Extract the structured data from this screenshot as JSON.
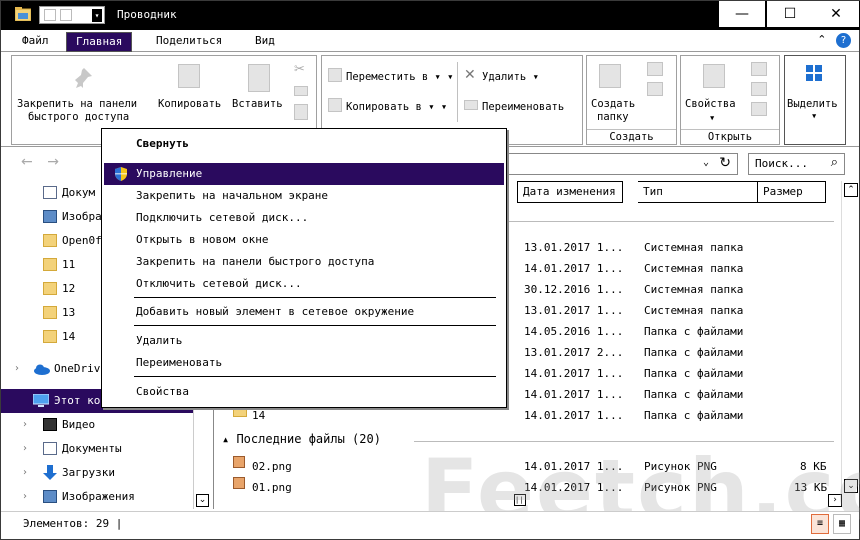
{
  "window": {
    "title": "Проводник",
    "qat_arrow": "▾",
    "minimize": "—",
    "maximize": "☐",
    "close": "✕"
  },
  "tabs": [
    "Файл",
    "Главная",
    "Поделиться",
    "Вид"
  ],
  "tabs_right": {
    "collapse": "⌃",
    "help": "?"
  },
  "ribbon": {
    "pin_label_1": "Закрепить на панели",
    "pin_label_2": "быстрого доступа",
    "copy_label": "Копировать",
    "paste_label": "Вставить",
    "move_to": "Переместить в",
    "copy_to": "Копировать в",
    "delete": "Удалить",
    "rename": "Переименовать",
    "new_folder_1": "Создать",
    "new_folder_2": "папку",
    "group_create": "Создать",
    "properties": "Свойства",
    "group_open": "Открыть",
    "select": "Выделить",
    "caret": "▾"
  },
  "nav": {
    "back": "←",
    "forward": "→",
    "address_caret": "⌄",
    "refresh": "↻",
    "search_placeholder": "Поиск...",
    "search_icon": "⌕"
  },
  "left_pane": {
    "items": [
      {
        "label": "Докум",
        "icon": "document-icon"
      },
      {
        "label": "Изобра",
        "icon": "images-icon"
      },
      {
        "label": "Open0f",
        "icon": "folder-icon"
      },
      {
        "label": "11",
        "icon": "folder-icon"
      },
      {
        "label": "12",
        "icon": "folder-icon"
      },
      {
        "label": "13",
        "icon": "folder-icon"
      },
      {
        "label": "14",
        "icon": "folder-icon"
      },
      {
        "label": "OneDriv",
        "icon": "onedrive-icon"
      },
      {
        "label": "Этот ко",
        "icon": "computer-icon"
      },
      {
        "label": "Видео",
        "icon": "video-icon"
      },
      {
        "label": "Документы",
        "icon": "document-icon"
      },
      {
        "label": "Загрузки",
        "icon": "download-icon"
      },
      {
        "label": "Изображения",
        "icon": "images-icon"
      }
    ],
    "expand": "›",
    "scroll_down": "⌄"
  },
  "columns": {
    "date": "Дата изменения",
    "type": "Тип",
    "size": "Размер"
  },
  "rows": [
    {
      "name": "",
      "date": "13.01.2017 1...",
      "type": "Системная папка",
      "size": ""
    },
    {
      "name": "",
      "date": "14.01.2017 1...",
      "type": "Системная папка",
      "size": ""
    },
    {
      "name": "",
      "date": "30.12.2016 1...",
      "type": "Системная папка",
      "size": ""
    },
    {
      "name": "",
      "date": "13.01.2017 1...",
      "type": "Системная папка",
      "size": ""
    },
    {
      "name": "",
      "date": "14.05.2016 1...",
      "type": "Папка с файлами",
      "size": ""
    },
    {
      "name": "",
      "date": "13.01.2017 2...",
      "type": "Папка с файлами",
      "size": ""
    },
    {
      "name": "",
      "date": "14.01.2017 1...",
      "type": "Папка с файлами",
      "size": ""
    },
    {
      "name": "",
      "date": "14.01.2017 1...",
      "type": "Папка с файлами",
      "size": ""
    },
    {
      "name": "14",
      "date": "14.01.2017 1...",
      "type": "Папка с файлами",
      "size": ""
    }
  ],
  "recent_group": "Последние файлы (20)",
  "recent_rows": [
    {
      "name": "02.png",
      "date": "14.01.2017 1...",
      "type": "Рисунок PNG",
      "size": "8 КБ"
    },
    {
      "name": "01.png",
      "date": "14.01.2017 1...",
      "type": "Рисунок PNG",
      "size": "13 КБ"
    }
  ],
  "status": {
    "count": "Элементов: 29 |"
  },
  "watermark": "Feetch.com",
  "context_menu": [
    {
      "label": "Свернуть",
      "bold": true
    },
    {
      "label": "Управление",
      "highlighted": true,
      "icon": "shield-icon"
    },
    {
      "label": "Закрепить на начальном экране"
    },
    {
      "label": "Подключить сетевой диск..."
    },
    {
      "label": "Открыть в новом окне"
    },
    {
      "label": "Закрепить на панели быстрого доступа"
    },
    {
      "label": "Отключить сетевой диск..."
    },
    {
      "label": "Добавить новый элемент в сетевое окружение"
    },
    {
      "label": "Удалить"
    },
    {
      "label": "Переименовать"
    },
    {
      "label": "Свойства"
    }
  ],
  "colors": {
    "accent": "#2a0a5e"
  }
}
